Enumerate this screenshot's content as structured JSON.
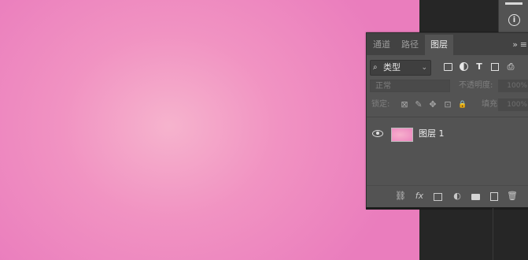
{
  "canvas": {
    "colors": {
      "center": "#f6b3cd",
      "edge": "#ea7dbd"
    }
  },
  "top_strip": {
    "icons": [
      "menu-icon",
      "info-icon"
    ],
    "info_glyph": "i"
  },
  "panel": {
    "tabs": [
      {
        "label": "通道",
        "active": false
      },
      {
        "label": "路径",
        "active": false
      },
      {
        "label": "图层",
        "active": true
      }
    ],
    "menu_glyph": "»",
    "menu_glyph2": "≡",
    "filter": {
      "search_glyph": "⌕",
      "value": "类型",
      "caret": "⌄",
      "icons": [
        "pixel-layer-filter-icon",
        "adjustment-layer-filter-icon",
        "type-layer-filter-icon",
        "shape-layer-filter-icon",
        "smart-object-filter-icon"
      ],
      "type_glyph": "T",
      "smart_glyph": "⎙"
    },
    "blend_mode": "正常",
    "opacity_label": "不透明度:",
    "opacity_value": "100%",
    "lock_label": "锁定:",
    "lock_glyphs": {
      "transparency": "⊠",
      "image": "✎",
      "position": "✥",
      "artboard": "⊡",
      "all": "🔒"
    },
    "fill_label": "填充:",
    "fill_value": "100%",
    "layers": [
      {
        "name": "图层 1",
        "visible": true
      }
    ],
    "bottom_icons": {
      "link": "⛓",
      "fx": "fx",
      "adjustment": "◐",
      "delete": "🗑"
    }
  }
}
